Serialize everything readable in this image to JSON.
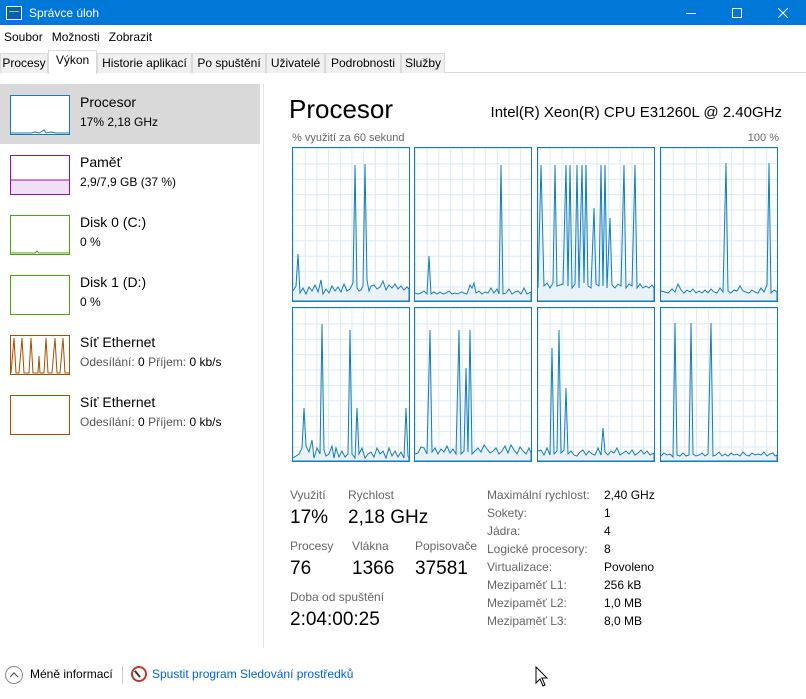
{
  "window": {
    "title": "Správce úloh",
    "controls": [
      "minimize-icon",
      "maximize-icon",
      "close-icon"
    ]
  },
  "menu": [
    "Soubor",
    "Možnosti",
    "Zobrazit"
  ],
  "tabs": [
    {
      "label": "Procesy",
      "active": false
    },
    {
      "label": "Výkon",
      "active": true
    },
    {
      "label": "Historie aplikací",
      "active": false
    },
    {
      "label": "Po spuštění",
      "active": false
    },
    {
      "label": "Uživatelé",
      "active": false
    },
    {
      "label": "Podrobnosti",
      "active": false
    },
    {
      "label": "Služby",
      "active": false
    }
  ],
  "sidebar": {
    "items": [
      {
        "title": "Procesor",
        "sub": "17% 2,18 GHz",
        "color": "#117dbb",
        "selected": true
      },
      {
        "title": "Paměť",
        "sub": "2,9/7,9 GB (37 %)",
        "color": "#8b12ae",
        "selected": false
      },
      {
        "title": "Disk 0 (C:)",
        "sub": "0 %",
        "color": "#4da60c",
        "selected": false
      },
      {
        "title": "Disk 1 (D:)",
        "sub": "0 %",
        "color": "#4da60c",
        "selected": false
      },
      {
        "title": "Síť Ethernet",
        "sub_send_label": "Odesílání:",
        "sub_send": "0",
        "sub_recv_label": "Příjem:",
        "sub_recv": "0 kb/s",
        "color": "#a74f01",
        "selected": false
      },
      {
        "title": "Síť Ethernet",
        "sub_send_label": "Odesílání:",
        "sub_send": "0",
        "sub_recv_label": "Příjem:",
        "sub_recv": "0 kb/s",
        "color": "#a74f01",
        "selected": false
      }
    ]
  },
  "main": {
    "title": "Procesor",
    "cpu_model": "Intel(R) Xeon(R) CPU E31260L @ 2.40GHz",
    "graph_label_left": "% využití za 60 sekund",
    "graph_label_right": "100 %",
    "graph_color": "#117dbb"
  },
  "stats": {
    "utilization_label": "Využití",
    "utilization": "17%",
    "speed_label": "Rychlost",
    "speed": "2,18 GHz",
    "processes_label": "Procesy",
    "processes": "76",
    "threads_label": "Vlákna",
    "threads": "1366",
    "handles_label": "Popisovače",
    "handles": "37581",
    "uptime_label": "Doba od spuštění",
    "uptime": "2:04:00:25"
  },
  "specs": [
    {
      "label": "Maximální rychlost:",
      "value": "2,40 GHz"
    },
    {
      "label": "Sokety:",
      "value": "1"
    },
    {
      "label": "Jádra:",
      "value": "4"
    },
    {
      "label": "Logické procesory:",
      "value": "8"
    },
    {
      "label": "Virtualizace:",
      "value": "Povoleno"
    },
    {
      "label": "Mezipaměť L1:",
      "value": "256 kB"
    },
    {
      "label": "Mezipaměť L2:",
      "value": "1,0 MB"
    },
    {
      "label": "Mezipaměť L3:",
      "value": "8,0 MB"
    }
  ],
  "bottom": {
    "less_info": "Méně informací",
    "resmon": "Spustit program Sledování prostředků"
  }
}
